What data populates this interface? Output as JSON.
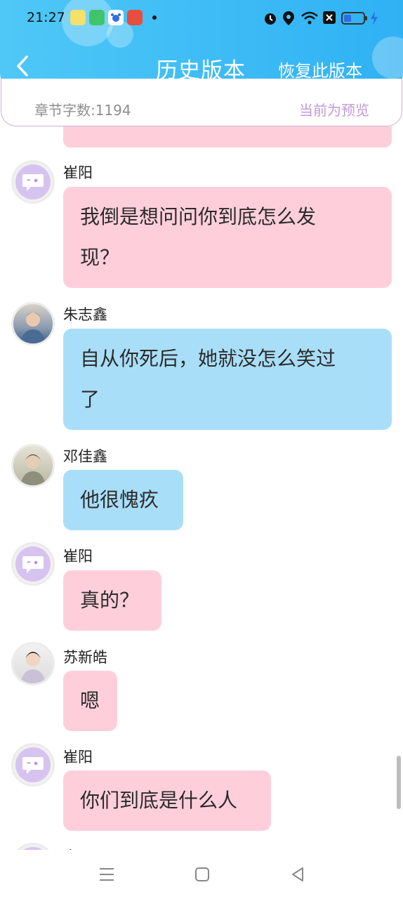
{
  "status_bar": {
    "time": "21:27",
    "icons": [
      "wechat-yellow-icon",
      "green-app-icon",
      "baidu-icon",
      "red-app-icon",
      "dot-icon",
      "alarm-icon",
      "location-icon",
      "wifi-icon",
      "no-sim-icon",
      "battery-icon",
      "charging-icon"
    ]
  },
  "header": {
    "title": "历史版本",
    "restore_label": "恢复此版本",
    "back_icon": "chevron-left-icon"
  },
  "info": {
    "word_count": "章节字数:1194",
    "preview_label": "当前为预览"
  },
  "messages": [
    {
      "name": "崔阳",
      "text_line1": "我倒是想问问你到底怎么发",
      "text_line2": "现？",
      "color": "#fecfdb",
      "avatar": "chat-bubble-avatar-icon"
    },
    {
      "name": "朱志鑫",
      "text_line1": "自从你死后，她就没怎么笑过",
      "text_line2": "了",
      "color": "#a9def9",
      "avatar": "user-photo-avatar"
    },
    {
      "name": "邓佳鑫",
      "text": "他很愧疚",
      "color": "#a9def9",
      "avatar": "user-photo-avatar"
    },
    {
      "name": "崔阳",
      "text": "真的？",
      "color": "#fecfdb",
      "avatar": "chat-bubble-avatar-icon"
    },
    {
      "name": "苏新皓",
      "text": "嗯",
      "color": "#fecfdb",
      "avatar": "user-photo-avatar"
    },
    {
      "name": "崔阳",
      "text": "你们到底是什么人",
      "color": "#fecfdb",
      "avatar": "chat-bubble-avatar-icon"
    },
    {
      "name": "崔阳",
      "avatar": "chat-bubble-avatar-icon"
    }
  ],
  "bottom_nav": [
    "menu-icon",
    "home-square-icon",
    "back-triangle-icon"
  ]
}
